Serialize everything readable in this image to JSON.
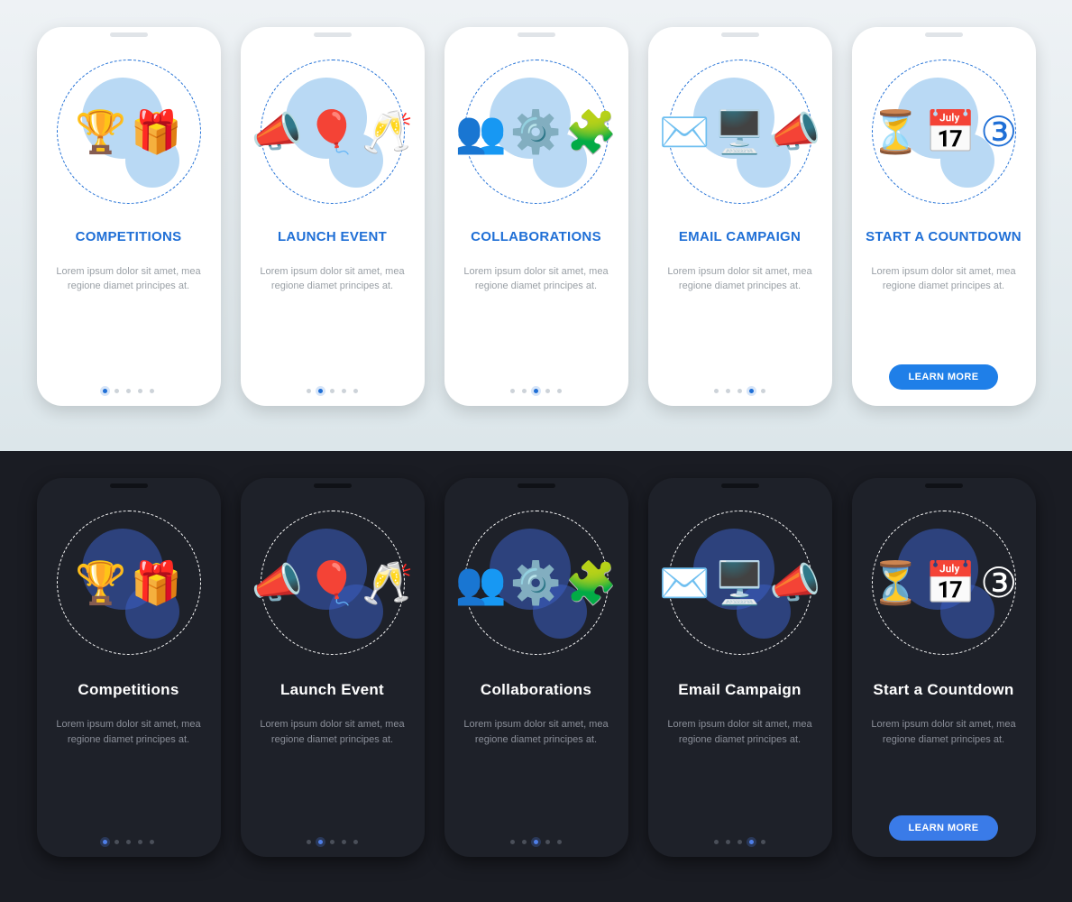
{
  "description": "Lorem ipsum dolor sit amet, mea regione diamet principes at.",
  "cta_label": "LEARN MORE",
  "light": {
    "cards": [
      {
        "title": "COMPETITIONS",
        "icon": "trophy",
        "dots": 5,
        "active": 0
      },
      {
        "title": "LAUNCH EVENT",
        "icon": "megaphone",
        "dots": 5,
        "active": 1
      },
      {
        "title": "COLLABORATIONS",
        "icon": "team",
        "dots": 5,
        "active": 2
      },
      {
        "title": "EMAIL CAMPAIGN",
        "icon": "mail",
        "dots": 5,
        "active": 3
      },
      {
        "title": "START A COUNTDOWN",
        "icon": "hourglass",
        "dots": 0,
        "active": -1,
        "cta": true
      }
    ]
  },
  "dark": {
    "cards": [
      {
        "title": "Competitions",
        "icon": "trophy",
        "dots": 5,
        "active": 0
      },
      {
        "title": "Launch Event",
        "icon": "megaphone",
        "dots": 5,
        "active": 1
      },
      {
        "title": "Collaborations",
        "icon": "team",
        "dots": 5,
        "active": 2
      },
      {
        "title": "Email Campaign",
        "icon": "mail",
        "dots": 5,
        "active": 3
      },
      {
        "title": "Start a Countdown",
        "icon": "hourglass",
        "dots": 0,
        "active": -1,
        "cta": true
      }
    ]
  },
  "glyphs": {
    "trophy": [
      "🏆",
      "🎁"
    ],
    "megaphone": [
      "📣",
      "🎈",
      "🥂"
    ],
    "team": [
      "👥",
      "⚙️",
      "🧩"
    ],
    "mail": [
      "✉️",
      "🖥️",
      "📣"
    ],
    "hourglass": [
      "⏳",
      "📅",
      "③"
    ]
  }
}
